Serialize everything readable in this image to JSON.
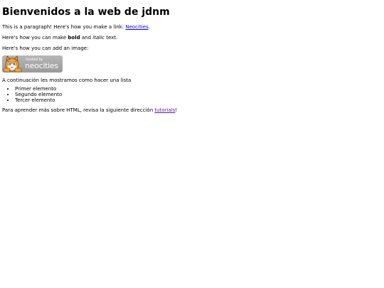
{
  "heading": "Bienvenidos a la web de jdnm",
  "para_link": {
    "before": "This is a paragraph! Here's how you make a link: ",
    "link_text": "Neocities",
    "after": "."
  },
  "para_bold": {
    "before": "Here's how you can make ",
    "bold": "bold",
    "middle": " and ",
    "italic": "italic",
    "after": " text."
  },
  "para_image": "Here's how you can add an image:",
  "badge": {
    "small_text": "hosted by",
    "big_text": "neocities"
  },
  "list_intro": "A continuación les mostramos como hacer una lista",
  "list_items": [
    "Primer elemento",
    "Segundo elemento",
    "Tercer elemento"
  ],
  "para_tutorials": {
    "before": "Para aprender más sobre HTML, revisa la siguiente dirección ",
    "link_text": "tutorials",
    "after": "!"
  },
  "colors": {
    "link": "#0000ee",
    "visited_link": "#551a8b",
    "badge_bg": "#a8a8a8"
  }
}
